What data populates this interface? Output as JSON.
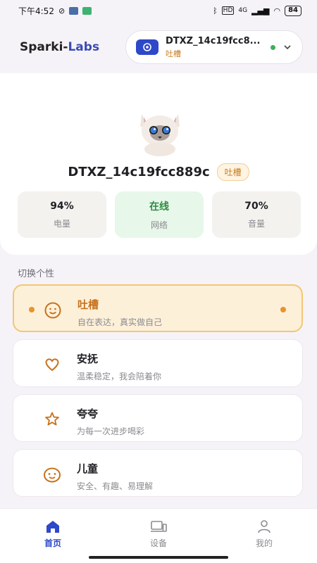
{
  "status_bar": {
    "time": "下午4:52",
    "battery": "84",
    "network": "4G"
  },
  "header": {
    "brand_prefix": "Sparki-",
    "brand_accent": "Labs",
    "device_name": "DTXZ_14c19fcc8...",
    "device_mode": "吐槽"
  },
  "profile": {
    "device_name": "DTXZ_14c19fcc889c",
    "mode_badge": "吐槽",
    "stats": [
      {
        "value": "94%",
        "label": "电量"
      },
      {
        "value": "在线",
        "label": "网络"
      },
      {
        "value": "70%",
        "label": "音量"
      }
    ]
  },
  "personality": {
    "section_title": "切换个性",
    "items": [
      {
        "title": "吐槽",
        "subtitle": "自在表达，真实做自己",
        "icon": "smile-icon",
        "active": true
      },
      {
        "title": "安抚",
        "subtitle": "温柔稳定，我会陪着你",
        "icon": "heart-icon",
        "active": false
      },
      {
        "title": "夸夸",
        "subtitle": "为每一次进步喝彩",
        "icon": "star-icon",
        "active": false
      },
      {
        "title": "儿童",
        "subtitle": "安全、有趣、易理解",
        "icon": "child-face-icon",
        "active": false
      }
    ]
  },
  "nav": {
    "items": [
      {
        "label": "首页",
        "icon": "home-icon",
        "active": true
      },
      {
        "label": "设备",
        "icon": "devices-icon",
        "active": false
      },
      {
        "label": "我的",
        "icon": "user-icon",
        "active": false
      }
    ]
  },
  "colors": {
    "accent_blue": "#2d48c8",
    "accent_orange": "#c7711a",
    "online_green": "#3fae5b"
  }
}
